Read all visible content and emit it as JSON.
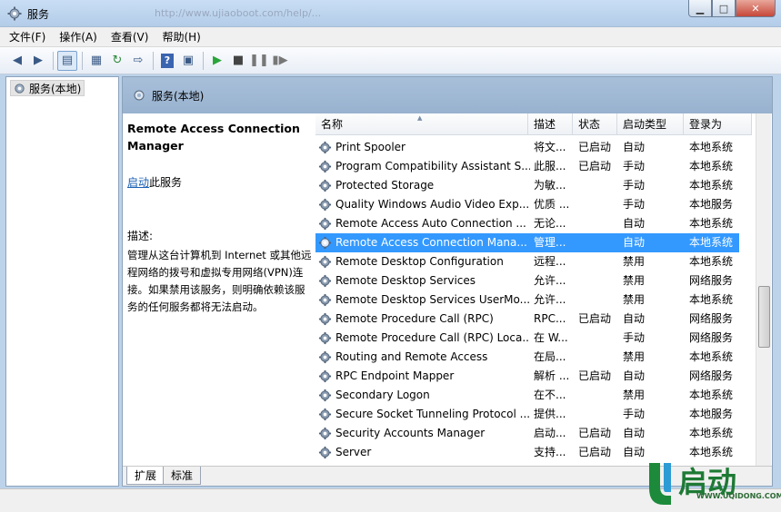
{
  "window": {
    "title": "服务",
    "address_hint": "http://www.ujiaoboot.com/help/..."
  },
  "menu": [
    {
      "label": "文件(F)"
    },
    {
      "label": "操作(A)"
    },
    {
      "label": "查看(V)"
    },
    {
      "label": "帮助(H)"
    }
  ],
  "tree": {
    "root_label": "服务(本地)"
  },
  "main": {
    "header": "服务(本地)",
    "description": {
      "title": "Remote Access Connection Manager",
      "start_link": "启动",
      "start_suffix": "此服务",
      "label": "描述:",
      "text": "管理从这台计算机到 Internet 或其他远程网络的拨号和虚拟专用网络(VPN)连接。如果禁用该服务，则明确依赖该服务的任何服务都将无法启动。"
    },
    "columns": [
      "名称",
      "描述",
      "状态",
      "启动类型",
      "登录为"
    ],
    "rows": [
      {
        "name": "Print Spooler",
        "desc": "将文...",
        "status": "已启动",
        "startup": "自动",
        "logon": "本地系统"
      },
      {
        "name": "Program Compatibility Assistant S...",
        "desc": "此服...",
        "status": "已启动",
        "startup": "手动",
        "logon": "本地系统"
      },
      {
        "name": "Protected Storage",
        "desc": "为敏...",
        "status": "",
        "startup": "手动",
        "logon": "本地系统"
      },
      {
        "name": "Quality Windows Audio Video Exp...",
        "desc": "优质 ...",
        "status": "",
        "startup": "手动",
        "logon": "本地服务"
      },
      {
        "name": "Remote Access Auto Connection ...",
        "desc": "无论...",
        "status": "",
        "startup": "自动",
        "logon": "本地系统"
      },
      {
        "name": "Remote Access Connection Mana...",
        "desc": "管理...",
        "status": "",
        "startup": "自动",
        "logon": "本地系统",
        "selected": true
      },
      {
        "name": "Remote Desktop Configuration",
        "desc": "远程...",
        "status": "",
        "startup": "禁用",
        "logon": "本地系统"
      },
      {
        "name": "Remote Desktop Services",
        "desc": "允许...",
        "status": "",
        "startup": "禁用",
        "logon": "网络服务"
      },
      {
        "name": "Remote Desktop Services UserMo...",
        "desc": "允许...",
        "status": "",
        "startup": "禁用",
        "logon": "本地系统"
      },
      {
        "name": "Remote Procedure Call (RPC)",
        "desc": "RPC...",
        "status": "已启动",
        "startup": "自动",
        "logon": "网络服务"
      },
      {
        "name": "Remote Procedure Call (RPC) Loca...",
        "desc": "在 W...",
        "status": "",
        "startup": "手动",
        "logon": "网络服务"
      },
      {
        "name": "Routing and Remote Access",
        "desc": "在局...",
        "status": "",
        "startup": "禁用",
        "logon": "本地系统"
      },
      {
        "name": "RPC Endpoint Mapper",
        "desc": "解析 ...",
        "status": "已启动",
        "startup": "自动",
        "logon": "网络服务"
      },
      {
        "name": "Secondary Logon",
        "desc": "在不...",
        "status": "",
        "startup": "禁用",
        "logon": "本地系统"
      },
      {
        "name": "Secure Socket Tunneling Protocol ...",
        "desc": "提供...",
        "status": "",
        "startup": "手动",
        "logon": "本地服务"
      },
      {
        "name": "Security Accounts Manager",
        "desc": "启动...",
        "status": "已启动",
        "startup": "自动",
        "logon": "本地系统"
      },
      {
        "name": "Server",
        "desc": "支持...",
        "status": "已启动",
        "startup": "自动",
        "logon": "本地系统"
      }
    ],
    "tabs": [
      "扩展",
      "标准"
    ]
  },
  "watermark": {
    "brand": "U启动",
    "url": "WWW.UQIDONG.COM"
  },
  "colors": {
    "selected_row": "#3399ff",
    "header_band": "#a8bfd9",
    "link": "#1a5fb4"
  }
}
